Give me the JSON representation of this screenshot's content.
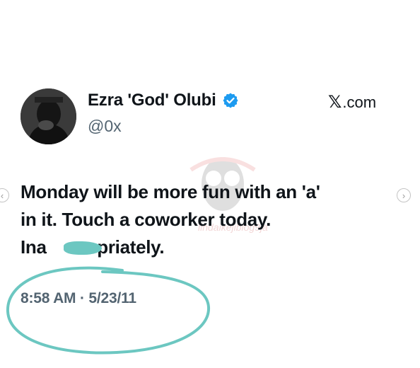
{
  "tweet": {
    "display_name": "Ezra 'God' Olubi",
    "handle": "@0x",
    "source_prefix": "𝕏",
    "source_suffix": ".com",
    "text_lines": [
      "Monday will be more fun with an 'a'",
      "in it. Touch a coworker today.",
      "Ina",
      "opriately."
    ],
    "timestamp": "8:58 AM · 5/23/11"
  },
  "watermark_text": "lindaikejiblog9ja",
  "icons": {
    "verified": "verified-badge-icon",
    "prev": "chevron-left-icon",
    "next": "chevron-right-icon"
  },
  "colors": {
    "verified": "#1d9bf0",
    "highlight": "#6cc7c1",
    "muted": "#536471"
  }
}
